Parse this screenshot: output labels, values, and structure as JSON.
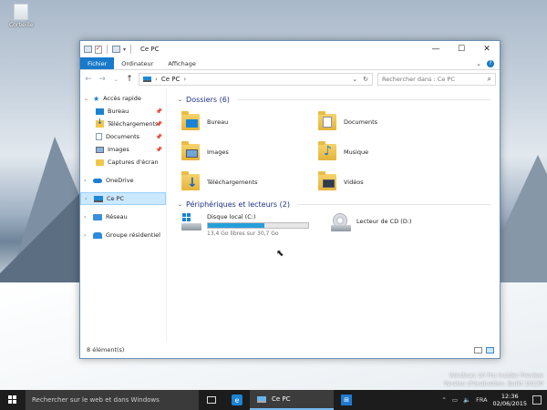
{
  "desktop": {
    "recycle_bin_label": "Corbeille",
    "watermark": {
      "line1": "Windows 10 Pro Insider Preview",
      "line2": "Version d'évaluation. Build 10130"
    }
  },
  "window": {
    "title": "Ce PC",
    "controls": {
      "minimize": "—",
      "maximize": "☐",
      "close": "✕"
    },
    "ribbon_tabs": [
      {
        "label": "Fichier",
        "active": true
      },
      {
        "label": "Ordinateur",
        "active": false
      },
      {
        "label": "Affichage",
        "active": false
      }
    ],
    "address": {
      "location": "Ce PC",
      "search_placeholder": "Rechercher dans : Ce PC"
    },
    "sidebar": [
      {
        "label": "Accès rapide",
        "icon": "star-icon",
        "level": 0
      },
      {
        "label": "Bureau",
        "icon": "desktop-folder-icon",
        "level": 1,
        "pinned": true
      },
      {
        "label": "Téléchargements",
        "icon": "downloads-folder-icon",
        "level": 1,
        "pinned": true
      },
      {
        "label": "Documents",
        "icon": "documents-folder-icon",
        "level": 1,
        "pinned": true
      },
      {
        "label": "Images",
        "icon": "pictures-folder-icon",
        "level": 1,
        "pinned": true
      },
      {
        "label": "Captures d'écran",
        "icon": "folder-icon",
        "level": 1
      },
      {
        "label": "OneDrive",
        "icon": "onedrive-icon",
        "level": 0
      },
      {
        "label": "Ce PC",
        "icon": "computer-icon",
        "level": 0,
        "selected": true
      },
      {
        "label": "Réseau",
        "icon": "network-icon",
        "level": 0
      },
      {
        "label": "Groupe résidentiel",
        "icon": "homegroup-icon",
        "level": 0
      }
    ],
    "folders_header": "Dossiers (6)",
    "folders": [
      {
        "label": "Bureau",
        "icon": "desktop-folder-icon"
      },
      {
        "label": "Documents",
        "icon": "documents-folder-icon"
      },
      {
        "label": "Images",
        "icon": "pictures-folder-icon"
      },
      {
        "label": "Musique",
        "icon": "music-folder-icon"
      },
      {
        "label": "Téléchargements",
        "icon": "downloads-folder-icon"
      },
      {
        "label": "Vidéos",
        "icon": "videos-folder-icon"
      }
    ],
    "devices_header": "Périphériques et lecteurs (2)",
    "devices": [
      {
        "label": "Disque local (C:)",
        "free_text": "13,4 Go libres sur 30,7 Go",
        "used_fraction": 0.56,
        "icon": "local-disk-icon"
      },
      {
        "label": "Lecteur de CD (D:)",
        "icon": "cd-drive-icon"
      }
    ],
    "status": "8 élément(s)"
  },
  "taskbar": {
    "search_placeholder": "Rechercher sur le web et dans Windows",
    "app_label": "Ce PC",
    "language": "FRA",
    "time": "12:36",
    "date": "02/06/2015"
  },
  "colors": {
    "accent": "#1979ca",
    "taskbar": "#1c1c1c",
    "disk_fill": "#26a0da"
  }
}
